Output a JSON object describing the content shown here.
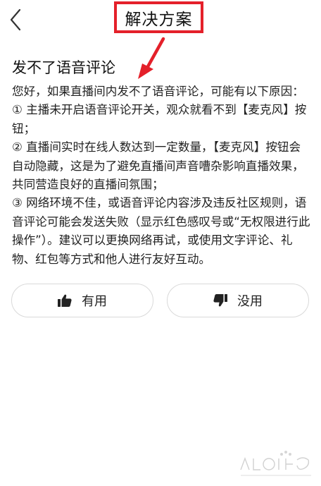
{
  "header": {
    "back_icon": "chevron-left-icon",
    "title": "解决方案",
    "highlight_color": "#e4202a"
  },
  "content": {
    "heading": "发不了语音评论",
    "paragraphs": [
      "您好，如果直播间内发不了语音评论，可能有以下原因：",
      "① 主播未开启语音评论开关，观众就看不到【麦克风】按钮；",
      "② 直播间实时在线人数达到一定数量，【麦克风】按钮会自动隐藏，这是为了避免直播间声音嘈杂影响直播效果，共同营造良好的直播间氛围；",
      "③ 网络环境不佳，或语音评论内容涉及违反社区规则，语音评论可能会发送失败（显示红色感叹号或“无权限进行此操作”）。建议可以更换网络再试，或使用文字评论、礼物、红包等方式和他人进行友好互动。"
    ]
  },
  "feedback": {
    "useful_label": "有用",
    "useful_icon": "thumbs-up-icon",
    "useless_label": "没用",
    "useless_icon": "thumbs-down-icon"
  },
  "watermark": {
    "logo": "baidu-jingyan-watermark"
  }
}
